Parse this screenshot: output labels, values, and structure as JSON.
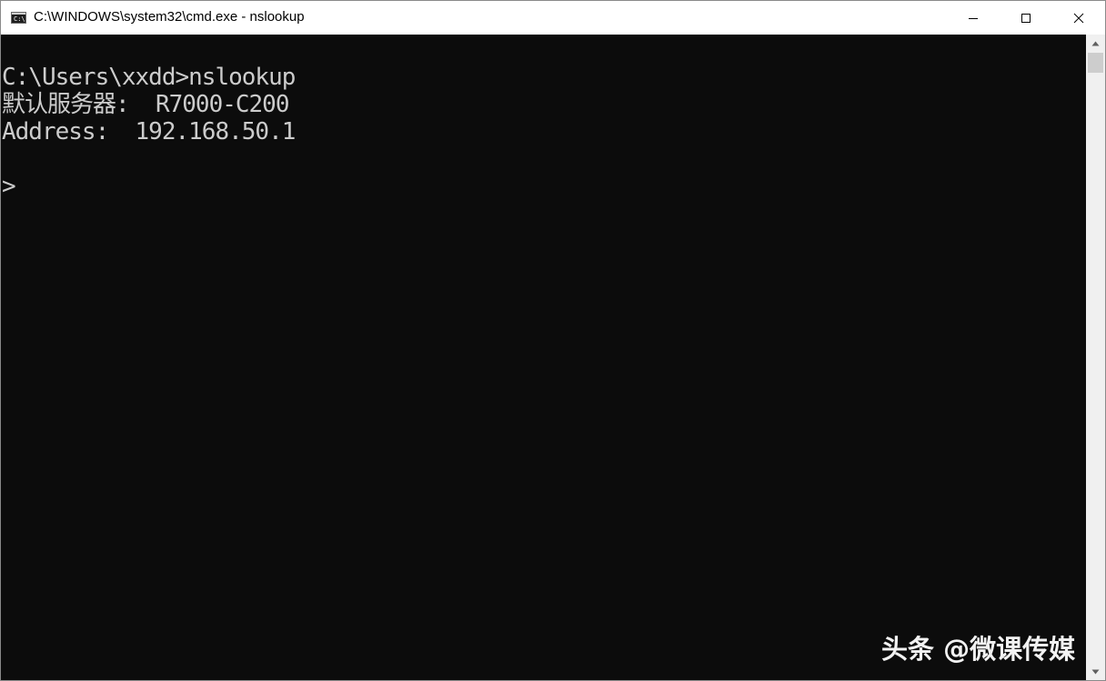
{
  "window": {
    "title": "C:\\WINDOWS\\system32\\cmd.exe - nslookup",
    "icon": "cmd-icon",
    "icon_prompt": "C:\\."
  },
  "controls": {
    "minimize_icon": "minimize-icon",
    "maximize_icon": "maximize-icon",
    "close_icon": "close-icon"
  },
  "console": {
    "lines": [
      "C:\\Users\\xxdd>nslookup",
      "默认服务器:  R7000-C200",
      "Address:  192.168.50.1",
      "",
      ">"
    ],
    "text_color": "#cccccc",
    "background_color": "#0c0c0c"
  },
  "watermark": {
    "text": "头条 @微课传媒"
  }
}
